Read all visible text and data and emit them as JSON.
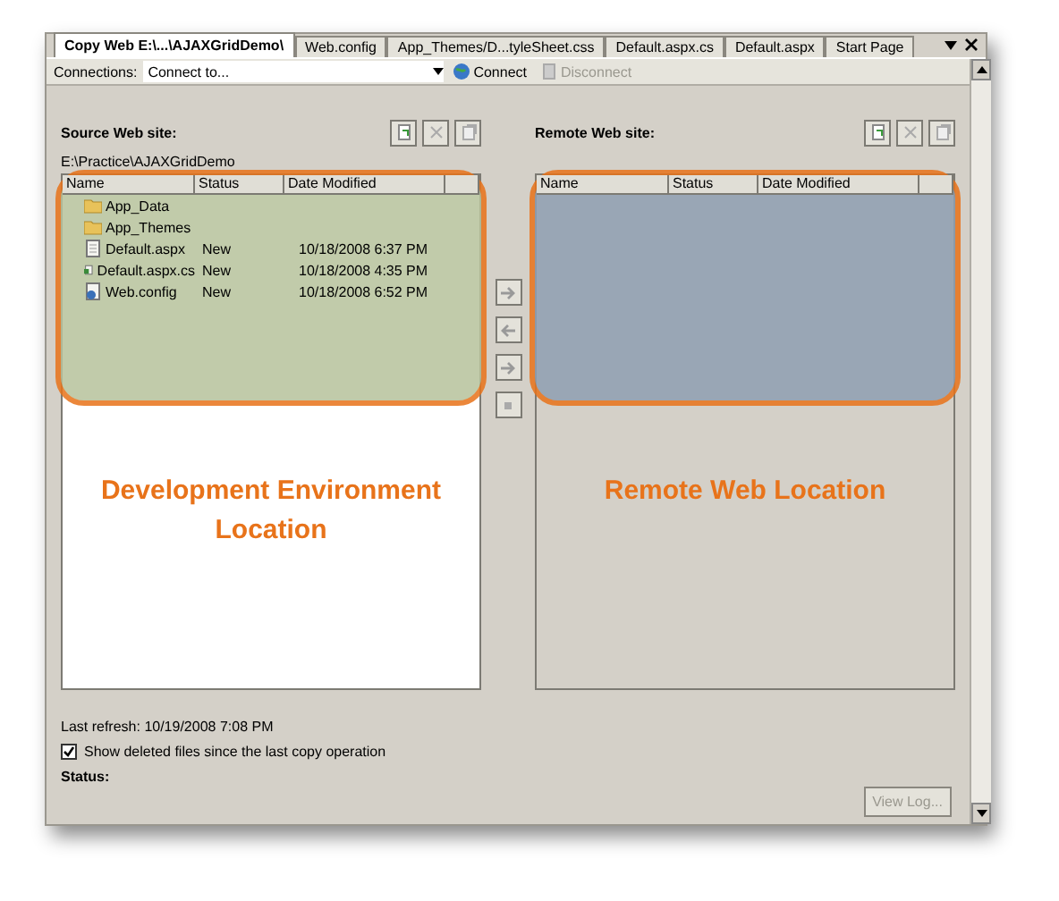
{
  "tabs": [
    {
      "label": "Copy Web E:\\...\\AJAXGridDemo\\",
      "selected": true
    },
    {
      "label": "Web.config",
      "selected": false
    },
    {
      "label": "App_Themes/D...tyleSheet.css",
      "selected": false
    },
    {
      "label": "Default.aspx.cs",
      "selected": false
    },
    {
      "label": "Default.aspx",
      "selected": false
    },
    {
      "label": "Start Page",
      "selected": false
    }
  ],
  "toolbar": {
    "label": "Connections:",
    "combo_value": "Connect to...",
    "connect": {
      "label": "Connect",
      "disabled": false
    },
    "disconnect": {
      "label": "Disconnect",
      "disabled": true
    }
  },
  "source": {
    "title": "Source Web site:",
    "path": "E:\\Practice\\AJAXGridDemo",
    "columns": [
      "Name",
      "Status",
      "Date Modified"
    ],
    "rows": [
      {
        "kind": "folder",
        "name": "App_Data",
        "status": "",
        "date": ""
      },
      {
        "kind": "folder",
        "name": "App_Themes",
        "status": "",
        "date": ""
      },
      {
        "kind": "page",
        "name": "Default.aspx",
        "status": "New",
        "date": "10/18/2008 6:37 PM"
      },
      {
        "kind": "code",
        "name": "Default.aspx.cs",
        "status": "New",
        "date": "10/18/2008 4:35 PM"
      },
      {
        "kind": "config",
        "name": "Web.config",
        "status": "New",
        "date": "10/18/2008 6:52 PM"
      }
    ],
    "callout": "Development Environment Location"
  },
  "remote": {
    "title": "Remote Web site:",
    "columns": [
      "Name",
      "Status",
      "Date Modified"
    ],
    "callout": "Remote Web Location"
  },
  "footer": {
    "last_refresh": "Last refresh: 10/19/2008 7:08 PM",
    "show_deleted": {
      "label": "Show deleted files since the last copy operation",
      "checked": true
    },
    "status_label": "Status:",
    "view_log": {
      "label": "View Log...",
      "disabled": true
    }
  }
}
